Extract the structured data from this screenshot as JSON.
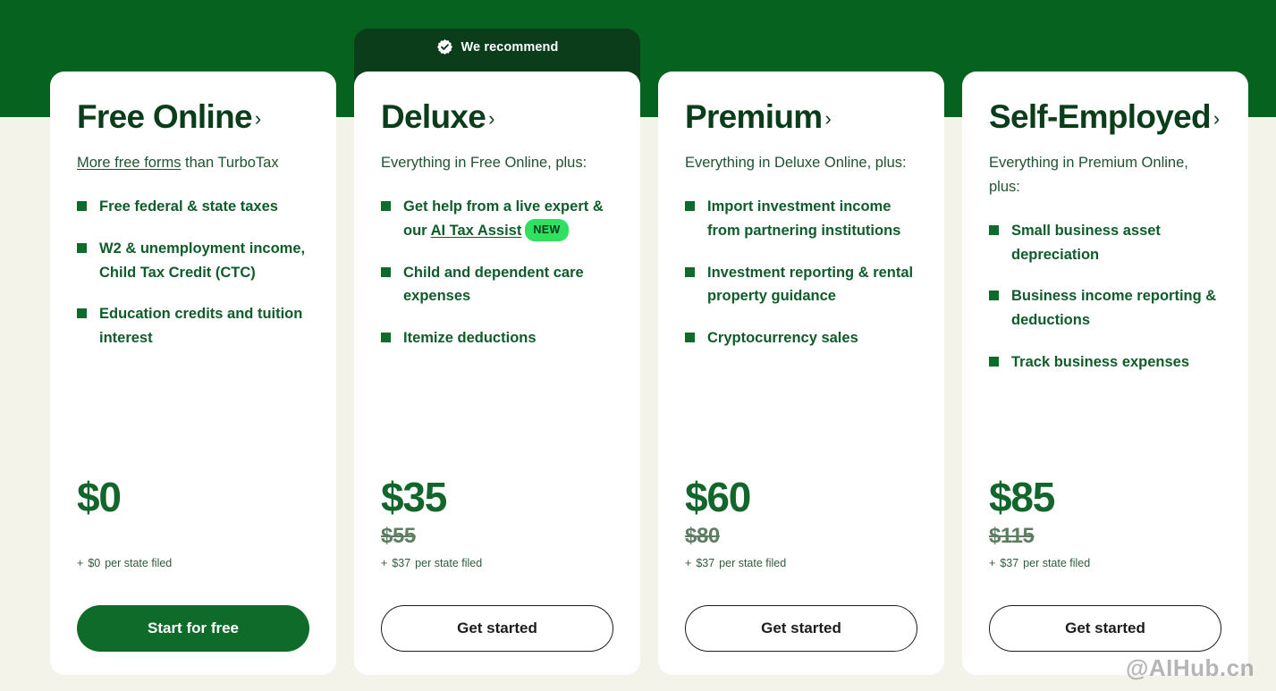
{
  "colors": {
    "band_green": "#05631f",
    "page_background": "#f4f3e9",
    "card_background": "#ffffff",
    "banner_green": "#0b3d1a",
    "title_green": "#0b3d1a",
    "feature_green": "#0f5c2a",
    "bullet_green": "#0f6b2a",
    "price_green": "#12662c",
    "old_price_gray": "#5e7e63",
    "new_badge_green": "#2fe061",
    "cta_primary": "#0f6b2a",
    "cta_secondary_border": "#1c1c1c"
  },
  "recommend_banner": {
    "label": "We recommend",
    "icon": "seal-check-icon"
  },
  "watermark": "@AIHub.cn",
  "cards": [
    {
      "title": "Free Online",
      "chevron": "›",
      "subtitle_link": "More free forms",
      "subtitle_rest": " than TurboTax",
      "features": [
        {
          "text": "Free federal & state taxes"
        },
        {
          "text": "W2 & unemployment income, Child Tax Credit (CTC)"
        },
        {
          "text": "Education credits and tuition interest"
        }
      ],
      "price": "$0",
      "old_price": "",
      "price_plus": "+",
      "price_state_amount": "$0",
      "price_state_label": "per state filed",
      "cta_label": "Start for free",
      "cta_style": "primary"
    },
    {
      "title": "Deluxe",
      "chevron": "›",
      "subtitle": "Everything in Free Online, plus:",
      "features": [
        {
          "text_before": "Get help from a live expert & our ",
          "link": "AI Tax Assist",
          "badge": "NEW"
        },
        {
          "text": "Child and dependent care expenses"
        },
        {
          "text": "Itemize deductions"
        }
      ],
      "price": "$35",
      "old_price": "$55",
      "price_plus": "+",
      "price_state_amount": "$37",
      "price_state_label": "per state filed",
      "cta_label": "Get started",
      "cta_style": "secondary"
    },
    {
      "title": "Premium",
      "chevron": "›",
      "subtitle": "Everything in Deluxe Online, plus:",
      "features": [
        {
          "text": "Import investment income from partnering institutions"
        },
        {
          "text": "Investment reporting & rental property guidance"
        },
        {
          "text": "Cryptocurrency sales"
        }
      ],
      "price": "$60",
      "old_price": "$80",
      "price_plus": "+",
      "price_state_amount": "$37",
      "price_state_label": "per state filed",
      "cta_label": "Get started",
      "cta_style": "secondary"
    },
    {
      "title": "Self-Employed",
      "chevron": "›",
      "subtitle": "Everything in Premium Online, plus:",
      "features": [
        {
          "text": "Small business asset depreciation"
        },
        {
          "text": "Business income reporting & deductions"
        },
        {
          "text": "Track business expenses"
        }
      ],
      "price": "$85",
      "old_price": "$115",
      "price_plus": "+",
      "price_state_amount": "$37",
      "price_state_label": "per state filed",
      "cta_label": "Get started",
      "cta_style": "secondary"
    }
  ]
}
